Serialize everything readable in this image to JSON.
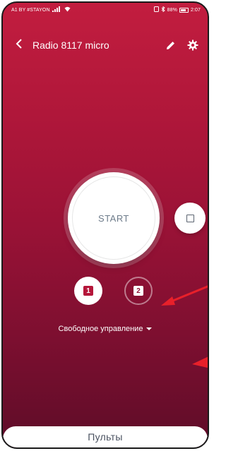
{
  "statusbar": {
    "carrier": "A1 BY #STAYON",
    "carrier_badge": "",
    "battery": "88%",
    "time": "2:07"
  },
  "header": {
    "title": "Radio 8117 micro"
  },
  "controls": {
    "start_label": "START",
    "channel_1": "1",
    "channel_2": "2",
    "mode_label": "Свободное управление"
  },
  "sheet": {
    "label": "Пульты"
  },
  "colors": {
    "gradient_top": "#c21d3f",
    "gradient_bottom": "#5e0c28",
    "annotation_arrow": "#e8202a"
  }
}
